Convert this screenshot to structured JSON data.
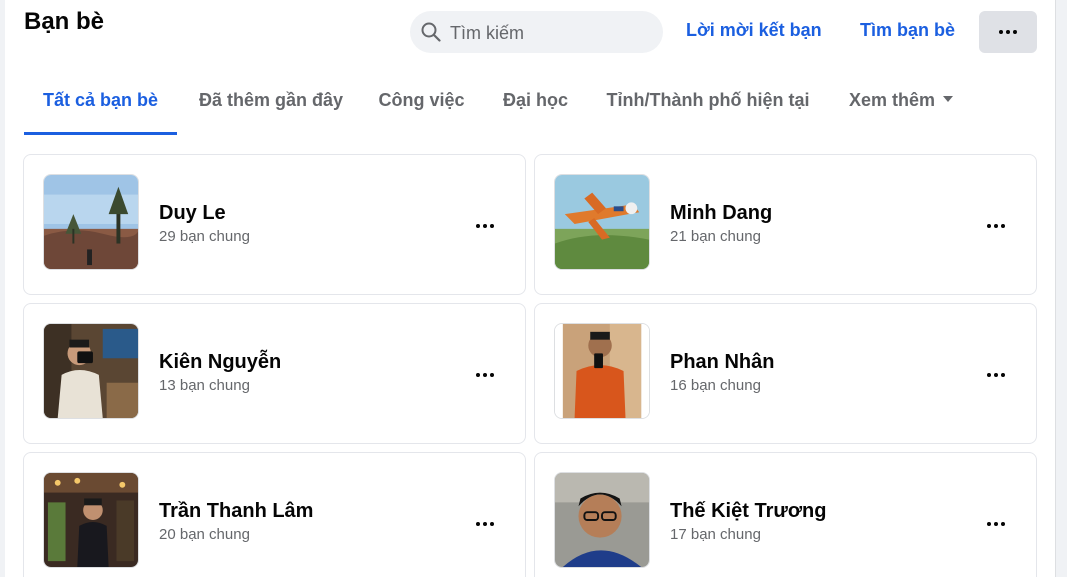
{
  "header": {
    "title": "Bạn bè",
    "search_placeholder": "Tìm kiếm",
    "friend_requests_link": "Lời mời kết bạn",
    "find_friends_link": "Tìm bạn bè",
    "more_icon": "more-horizontal-icon"
  },
  "tabs": [
    {
      "label": "Tất cả bạn bè",
      "active": true
    },
    {
      "label": "Đã thêm gần đây",
      "active": false
    },
    {
      "label": "Công việc",
      "active": false
    },
    {
      "label": "Đại học",
      "active": false
    },
    {
      "label": "Tỉnh/Thành phố hiện tại",
      "active": false
    },
    {
      "label": "Xem thêm",
      "active": false
    }
  ],
  "friends": [
    {
      "name": "Duy Le",
      "mutual": "29 bạn chung"
    },
    {
      "name": "Minh Dang",
      "mutual": "21 bạn chung"
    },
    {
      "name": "Kiên Nguyễn",
      "mutual": "13 bạn chung"
    },
    {
      "name": "Phan Nhân",
      "mutual": "16 bạn chung"
    },
    {
      "name": "Trần Thanh Lâm",
      "mutual": "20 bạn chung"
    },
    {
      "name": "Thế Kiệt Trương",
      "mutual": "17 bạn chung"
    }
  ],
  "colors": {
    "accent": "#1b5fe0",
    "secondary_text": "#65676b",
    "primary_text": "#050505"
  }
}
